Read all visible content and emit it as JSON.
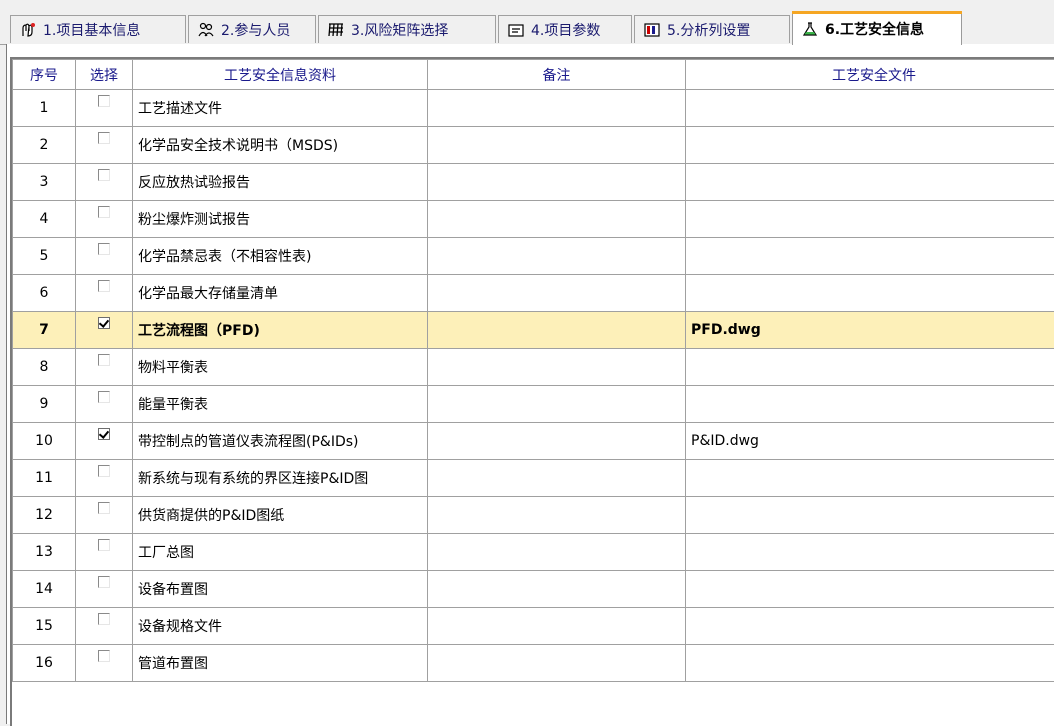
{
  "tabs": [
    {
      "label": "1.项目基本信息",
      "icon": "project-info-icon"
    },
    {
      "label": "2.参与人员",
      "icon": "people-icon"
    },
    {
      "label": "3.风险矩阵选择",
      "icon": "matrix-icon"
    },
    {
      "label": "4.项目参数",
      "icon": "parameters-icon"
    },
    {
      "label": "5.分析列设置",
      "icon": "columns-icon"
    },
    {
      "label": "6.工艺安全信息",
      "icon": "flask-icon",
      "active": true
    }
  ],
  "table": {
    "headers": {
      "no": "序号",
      "select": "选择",
      "info": "工艺安全信息资料",
      "note": "备注",
      "file": "工艺安全文件"
    },
    "rows": [
      {
        "no": "1",
        "checked": false,
        "info": "工艺描述文件",
        "note": "",
        "file": ""
      },
      {
        "no": "2",
        "checked": false,
        "info": "化学品安全技术说明书（MSDS)",
        "note": "",
        "file": ""
      },
      {
        "no": "3",
        "checked": false,
        "info": "反应放热试验报告",
        "note": "",
        "file": ""
      },
      {
        "no": "4",
        "checked": false,
        "info": "粉尘爆炸测试报告",
        "note": "",
        "file": ""
      },
      {
        "no": "5",
        "checked": false,
        "info": "化学品禁忌表（不相容性表)",
        "note": "",
        "file": ""
      },
      {
        "no": "6",
        "checked": false,
        "info": "化学品最大存储量清单",
        "note": "",
        "file": ""
      },
      {
        "no": "7",
        "checked": true,
        "info": "工艺流程图（PFD)",
        "note": "",
        "file": "PFD.dwg",
        "selected": true
      },
      {
        "no": "8",
        "checked": false,
        "info": "物料平衡表",
        "note": "",
        "file": ""
      },
      {
        "no": "9",
        "checked": false,
        "info": "能量平衡表",
        "note": "",
        "file": ""
      },
      {
        "no": "10",
        "checked": true,
        "info": "带控制点的管道仪表流程图(P&IDs)",
        "note": "",
        "file": "P&ID.dwg"
      },
      {
        "no": "11",
        "checked": false,
        "info": "新系统与现有系统的界区连接P&ID图",
        "note": "",
        "file": ""
      },
      {
        "no": "12",
        "checked": false,
        "info": "供货商提供的P&ID图纸",
        "note": "",
        "file": ""
      },
      {
        "no": "13",
        "checked": false,
        "info": "工厂总图",
        "note": "",
        "file": ""
      },
      {
        "no": "14",
        "checked": false,
        "info": "设备布置图",
        "note": "",
        "file": ""
      },
      {
        "no": "15",
        "checked": false,
        "info": "设备规格文件",
        "note": "",
        "file": ""
      },
      {
        "no": "16",
        "checked": false,
        "info": "管道布置图",
        "note": "",
        "file": ""
      }
    ]
  },
  "colors": {
    "selected_row": "#fdf0b9",
    "active_tab_accent": "#f5a623",
    "header_text": "#1a1a8c"
  }
}
